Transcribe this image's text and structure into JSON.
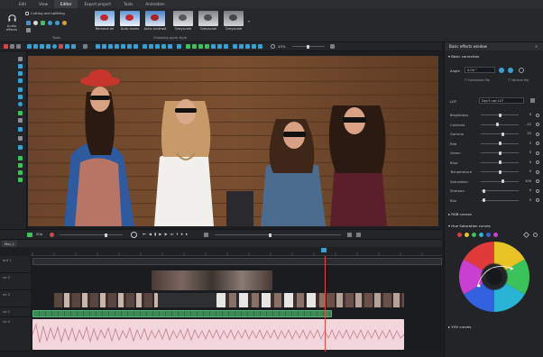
{
  "menu": {
    "items": [
      "Edit",
      "View",
      "Editor",
      "Export project",
      "Tools",
      "Animation"
    ],
    "active_index": 2
  },
  "ribbon": {
    "audio_effects": "Audio effects",
    "cutting": "Cutting and splitting",
    "tools_label": "Tools",
    "quick_style_label": "Choosing quick style",
    "styles": [
      "Remove all",
      "Auto levels",
      "Auto contrast",
      "Greyscale",
      "Greyscale",
      "Greyscale"
    ]
  },
  "toolbar": {
    "zoom": "43%"
  },
  "playback": {
    "zoom": "50p"
  },
  "timeline": {
    "tab": "Mai_1",
    "tracks": [
      "ent 1",
      "ne 2",
      "ne 3",
      "ne 1",
      "ne 4"
    ]
  },
  "panel": {
    "title": "Basic effects window",
    "section_basic": "Basic correction",
    "angle_label": "Angle",
    "angle_value": "0.00 °",
    "flip_h": "Horizontal flip",
    "flip_v": "Vertical flip",
    "lut_label": "LUT",
    "lut_value": "Don't use LUT",
    "sliders": [
      {
        "label": "Brightness",
        "value": "0",
        "pos": 0.5
      },
      {
        "label": "Contrast",
        "value": "-12",
        "pos": 0.44
      },
      {
        "label": "Gamma",
        "value": "22",
        "pos": 0.6
      },
      {
        "label": "Red",
        "value": "2",
        "pos": 0.52
      },
      {
        "label": "Green",
        "value": "0",
        "pos": 0.5
      },
      {
        "label": "Blue",
        "value": "0",
        "pos": 0.5
      },
      {
        "label": "Temperature",
        "value": "0",
        "pos": 0.5
      },
      {
        "label": "Saturation",
        "value": "100",
        "pos": 0.58
      },
      {
        "label": "Sharpen",
        "value": "0",
        "pos": 0.05
      },
      {
        "label": "Blur",
        "value": "0",
        "pos": 0.05
      }
    ],
    "rgb_curves": "RGB curves",
    "hue_sat": "Hue Saturation curves",
    "yuv_curves": "YUV curves",
    "swatches": [
      "#e03a3a",
      "#e8c326",
      "#3cc25a",
      "#29b4d6",
      "#3361e0",
      "#c93fd0"
    ]
  }
}
